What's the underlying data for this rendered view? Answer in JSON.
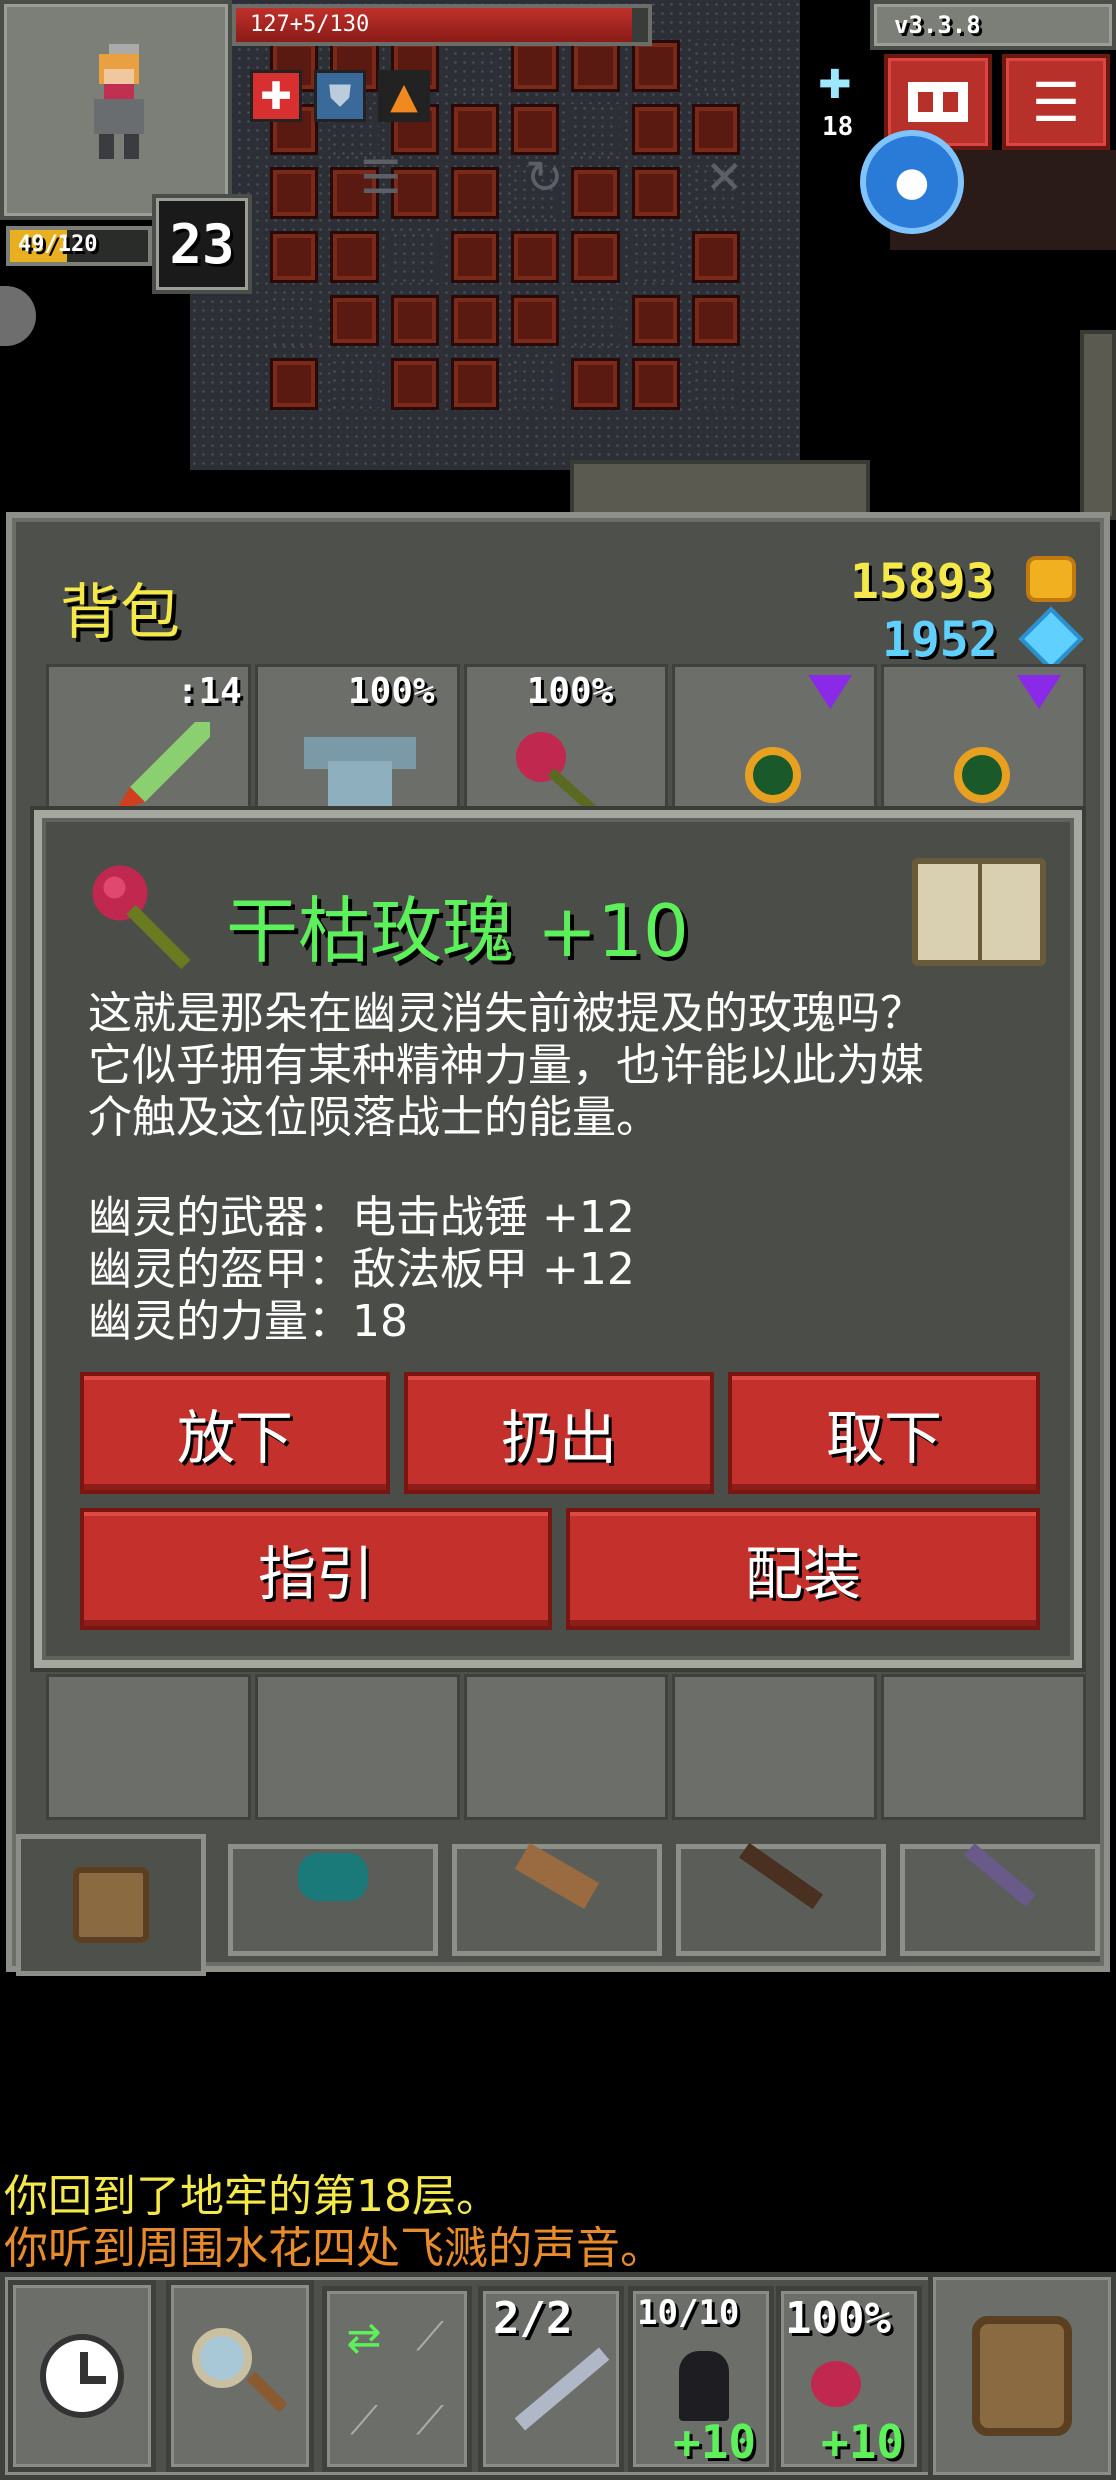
{
  "hud": {
    "hp_text": "127+5/130",
    "hp_fraction": 0.96,
    "exp_text": "49/120",
    "exp_fraction": 0.41,
    "level": "23",
    "version": "v3.3.8",
    "depth": "18",
    "buffs": [
      "healing-cross-icon",
      "shield-icon",
      "arrow-up-icon"
    ]
  },
  "bag": {
    "title": "背包",
    "gold": "15893",
    "energy": "1952",
    "top_row": [
      {
        "label": ":14",
        "icon": "spear-icon"
      },
      {
        "label": "100%",
        "icon": "armor-icon"
      },
      {
        "label": "100%",
        "icon": "rose-icon"
      },
      {
        "label": "",
        "icon": "ring-icon"
      },
      {
        "label": "",
        "icon": "ring-icon"
      }
    ]
  },
  "item": {
    "name": "干枯玫瑰 +10",
    "description": [
      "这就是那朵在幽灵消失前被提及的玫瑰吗？",
      "它似乎拥有某种精神力量，也许能以此为媒",
      "介触及这位陨落战士的能量。"
    ],
    "stats": [
      "幽灵的武器：电击战锤 +12",
      "幽灵的盔甲：敌法板甲 +12",
      "幽灵的力量：18"
    ],
    "buttons": {
      "drop": "放下",
      "throw": "扔出",
      "unequip": "取下",
      "guide": "指引",
      "equip": "配装"
    }
  },
  "log": {
    "line1": "你回到了地牢的第18层。",
    "line2": "你听到周围水花四处飞溅的声音。"
  },
  "toolbar": {
    "quick1_count": "2/2",
    "quick2_count": "10/10",
    "quick3_count": "100%",
    "quick2_bonus": "+10",
    "quick3_bonus": "+10"
  },
  "colors": {
    "button_red": "#c4302b",
    "gold_text": "#f5e94a",
    "energy_text": "#5fd0ff",
    "item_name": "#5cf05a",
    "log_yellow": "#f5e94a",
    "log_orange": "#e88b2a"
  }
}
